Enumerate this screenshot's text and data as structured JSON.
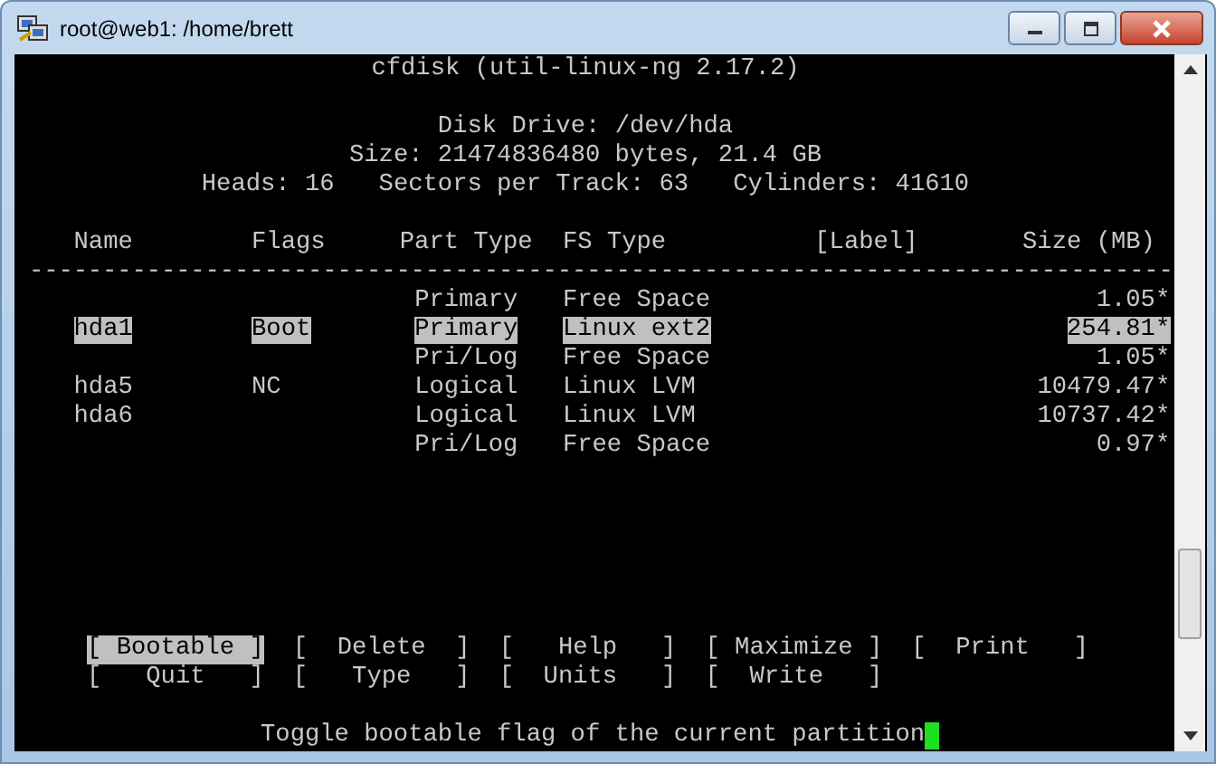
{
  "window": {
    "title": "root@web1: /home/brett"
  },
  "header": [
    "cfdisk (util-linux-ng 2.17.2)",
    "Disk Drive: /dev/hda",
    "Size: 21474836480 bytes, 21.4 GB",
    "Heads: 16   Sectors per Track: 63   Cylinders: 41610"
  ],
  "table": {
    "columns": [
      "Name",
      "Flags",
      "Part Type",
      "FS Type",
      "[Label]",
      "Size (MB)"
    ],
    "divider": "------------------------------------------------------------------------------",
    "rows": [
      {
        "part_type": "Primary",
        "fs_type": "Free Space",
        "size": "1.05*",
        "selected": false
      },
      {
        "name": "hda1",
        "flags": "Boot",
        "part_type": "Primary",
        "fs_type": "Linux ext2",
        "size": "254.81*",
        "selected": true
      },
      {
        "part_type": "Pri/Log",
        "fs_type": "Free Space",
        "size": "1.05*",
        "selected": false
      },
      {
        "name": "hda5",
        "flags": "NC",
        "part_type": "Logical",
        "fs_type": "Linux LVM",
        "size": "10479.47*",
        "selected": false
      },
      {
        "name": "hda6",
        "part_type": "Logical",
        "fs_type": "Linux LVM",
        "size": "10737.42*",
        "selected": false
      },
      {
        "part_type": "Pri/Log",
        "fs_type": "Free Space",
        "size": "0.97*",
        "selected": false
      }
    ]
  },
  "menu": [
    {
      "label": "[ Bootable ]",
      "selected": true
    },
    {
      "label": "[  Delete  ]",
      "selected": false
    },
    {
      "label": "[   Help   ]",
      "selected": false
    },
    {
      "label": "[ Maximize ]",
      "selected": false
    },
    {
      "label": "[  Print   ]",
      "selected": false
    },
    {
      "label": "[   Quit   ]",
      "selected": false
    },
    {
      "label": "[   Type   ]",
      "selected": false
    },
    {
      "label": "[  Units   ]",
      "selected": false
    },
    {
      "label": "[  Write   ]",
      "selected": false
    }
  ],
  "status_line": "Toggle bootable flag of the current partition"
}
